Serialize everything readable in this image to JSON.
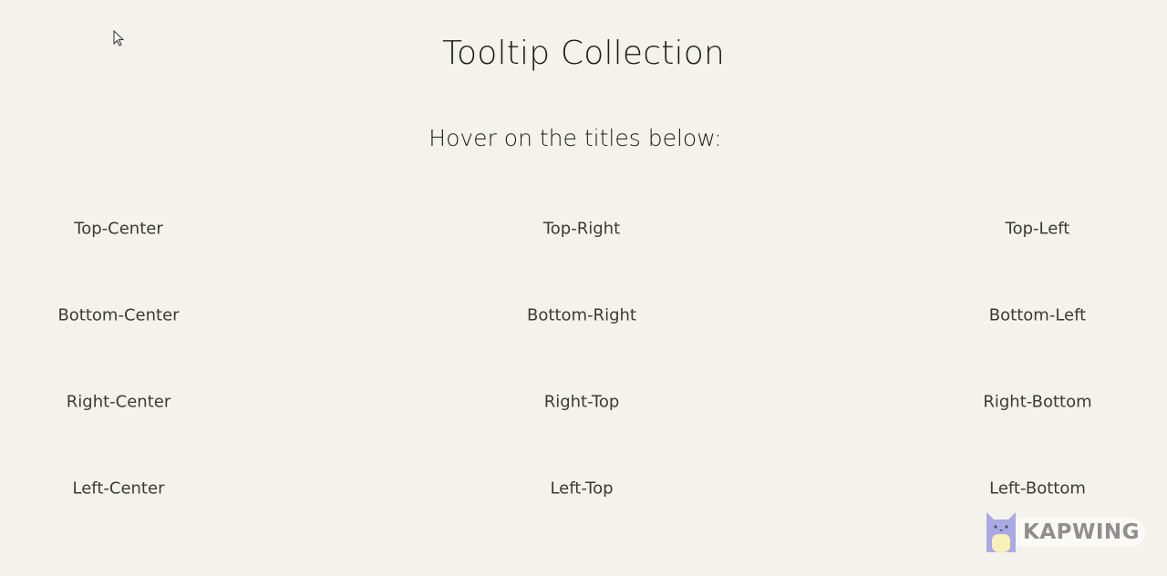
{
  "page": {
    "title": "Tooltip Collection",
    "subtitle": "Hover on the titles below:"
  },
  "tooltips": [
    "Top-Center",
    "Top-Right",
    "Top-Left",
    "Bottom-Center",
    "Bottom-Right",
    "Bottom-Left",
    "Right-Center",
    "Right-Top",
    "Right-Bottom",
    "Left-Center",
    "Left-Top",
    "Left-Bottom"
  ],
  "watermark": {
    "text": "KAPWING"
  },
  "icons": {
    "cursor": "mouse-pointer-icon",
    "watermark_logo": "kapwing-cat-icon"
  },
  "colors": {
    "background": "#f3f2ec",
    "text": "#2b2b2b",
    "watermark": "#8f8f8f",
    "logo_purple": "#a9a9e6",
    "logo_yellow": "#f7f0b8"
  }
}
